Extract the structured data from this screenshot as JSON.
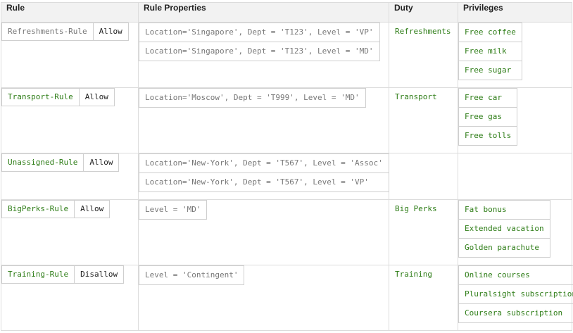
{
  "headers": {
    "rule": "Rule",
    "props": "Rule Properties",
    "duty": "Duty",
    "privileges": "Privileges"
  },
  "rows": [
    {
      "rule": "Refreshments-Rule",
      "action": "Allow",
      "props": [
        "Location='Singapore', Dept = 'T123', Level = 'VP'",
        "Location='Singapore', Dept = 'T123', Level = 'MD'"
      ],
      "duty": "Refreshments",
      "privileges": [
        "Free coffee",
        "Free milk",
        "Free sugar"
      ]
    },
    {
      "rule": "Transport-Rule",
      "action": "Allow",
      "props": [
        "Location='Moscow', Dept = 'T999', Level = 'MD'"
      ],
      "duty": "Transport",
      "privileges": [
        "Free car",
        "Free gas",
        "Free tolls"
      ]
    },
    {
      "rule": "Unassigned-Rule",
      "action": "Allow",
      "props": [
        "Location='New-York', Dept = 'T567', Level = 'Assoc'",
        "Location='New-York', Dept = 'T567', Level = 'VP'"
      ],
      "duty": "",
      "privileges": []
    },
    {
      "rule": "BigPerks-Rule",
      "action": "Allow",
      "props": [
        "Level = 'MD'"
      ],
      "duty": "Big Perks",
      "privileges": [
        "Fat bonus",
        "Extended vacation",
        "Golden parachute"
      ]
    },
    {
      "rule": "Training-Rule",
      "action": "Disallow",
      "props": [
        "Level = 'Contingent'"
      ],
      "duty": "Training",
      "privileges": [
        "Online courses",
        "Pluralsight subscription",
        "Coursera subscription"
      ]
    }
  ],
  "colors": {
    "green": "#2e7d17",
    "gray_text": "#777777",
    "header_bg": "#f2f2f2",
    "border": "#dcdcdc"
  }
}
